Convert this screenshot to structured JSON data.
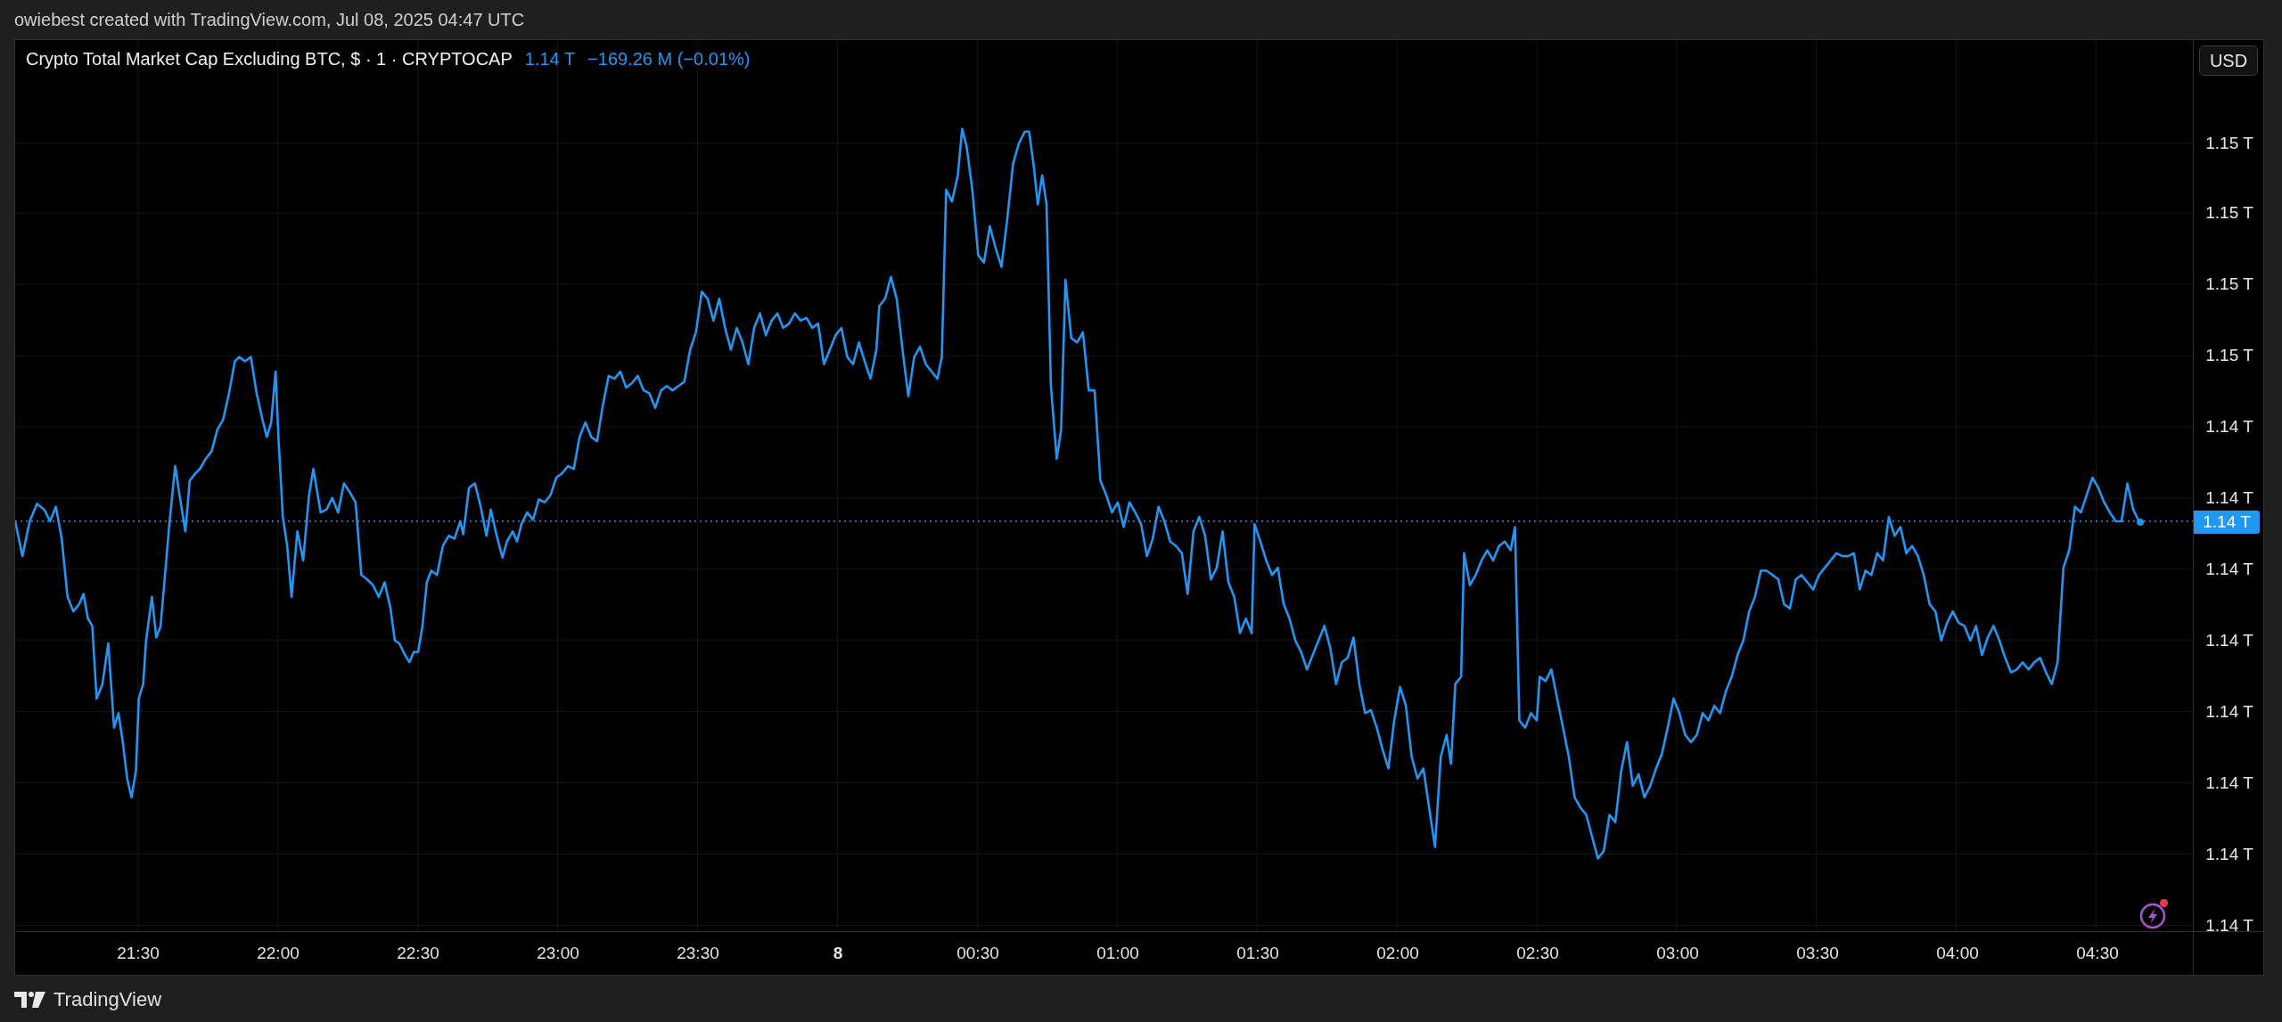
{
  "attribution": "owiebest created with TradingView.com, Jul 08, 2025 04:47 UTC",
  "legend": {
    "title": "Crypto Total Market Cap Excluding BTC, $ · 1 · CRYPTOCAP",
    "price": "1.14 T",
    "change": "−169.26 M (−0.01%)"
  },
  "currency_button": "USD",
  "price_axis": [
    "1.15 T",
    "1.15 T",
    "1.15 T",
    "1.15 T",
    "1.14 T",
    "1.14 T",
    "1.14 T",
    "1.14 T",
    "1.14 T",
    "1.14 T",
    "1.14 T",
    "1.14 T"
  ],
  "current_price_label": "1.14 T",
  "time_axis": [
    {
      "label": "21:30",
      "bold": false
    },
    {
      "label": "22:00",
      "bold": false
    },
    {
      "label": "22:30",
      "bold": false
    },
    {
      "label": "23:00",
      "bold": false
    },
    {
      "label": "23:30",
      "bold": false
    },
    {
      "label": "8",
      "bold": true
    },
    {
      "label": "00:30",
      "bold": false
    },
    {
      "label": "01:00",
      "bold": false
    },
    {
      "label": "01:30",
      "bold": false
    },
    {
      "label": "02:00",
      "bold": false
    },
    {
      "label": "02:30",
      "bold": false
    },
    {
      "label": "03:00",
      "bold": false
    },
    {
      "label": "03:30",
      "bold": false
    },
    {
      "label": "04:00",
      "bold": false
    },
    {
      "label": "04:30",
      "bold": false
    }
  ],
  "alert_badge": {
    "unread": true
  },
  "footer_logo": "TradingView"
}
